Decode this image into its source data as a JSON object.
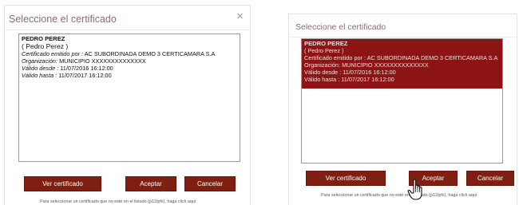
{
  "left_dialog": {
    "title": "Seleccione el certificado",
    "close_label": "×",
    "certificate": {
      "name": "PEDRO PEREZ",
      "display_name": "( Pedro Perez                    )",
      "issuer_label": "Certificado emitido por :",
      "issuer_value": "AC SUBORDINADA DEMO 3 CERTICAMARA S.A",
      "org_label": "Organización:",
      "org_value": "MUNICIPIO  XXXXXXXXXXXXXX",
      "valid_from_label": "Válido desde :",
      "valid_from_value": "11/07/2016 16:12:00",
      "valid_to_label": "Válido hasta :",
      "valid_to_value": "11/07/2017 16:12:00"
    },
    "buttons": {
      "view": "Ver certificado",
      "accept": "Aceptar",
      "cancel": "Cancelar"
    },
    "footer": "Para seleccionar un certificado que no esté en el listado (p12/pfx), haga click aquí"
  },
  "right_dialog": {
    "title": "Seleccione el certificado",
    "certificate": {
      "name": "PEDRO PEREZ",
      "display_name": "( Pedro Perez                    )",
      "issuer_label": "Certificado emitido por :",
      "issuer_value": "AC SUBORDINADA DEMO 3 CERTICAMARA S.A",
      "org_label": "Organización:",
      "org_value": "MUNICIPIO  XXXXXXXXXXXXXX",
      "valid_from_label": "Válido desde :",
      "valid_from_value": "11/07/2016 16:12:00",
      "valid_to_label": "Válido hasta :",
      "valid_to_value": "11/07/2017 16:12:00"
    },
    "buttons": {
      "view": "Ver certificado",
      "accept": "Aceptar",
      "cancel": "Cancelar"
    },
    "footer": "Para seleccionar un certificado que no esté en el listado (p12/pfx), haga click aquí"
  },
  "colors": {
    "button_bg": "#7e1f12",
    "selection_bg": "#8c1414",
    "title_text": "#8a6f6f"
  },
  "icons": {
    "cursor": "hand-pointer-icon"
  }
}
